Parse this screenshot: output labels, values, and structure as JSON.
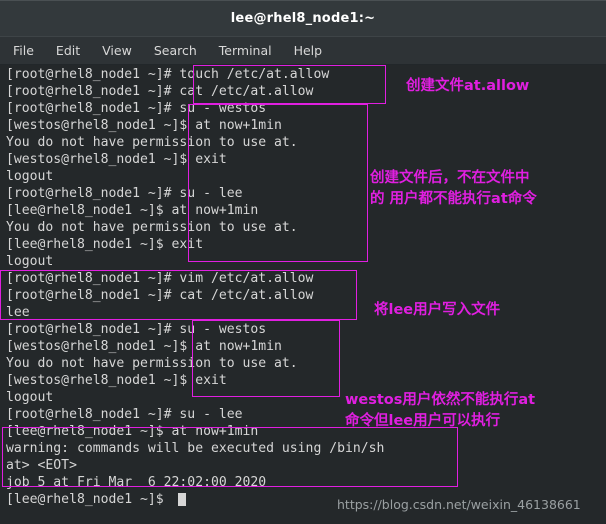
{
  "window": {
    "title": "lee@rhel8_node1:~"
  },
  "menubar": {
    "items": [
      {
        "label": "File"
      },
      {
        "label": "Edit"
      },
      {
        "label": "View"
      },
      {
        "label": "Search"
      },
      {
        "label": "Terminal"
      },
      {
        "label": "Help"
      }
    ]
  },
  "terminal": {
    "lines": [
      "[root@rhel8_node1 ~]# touch /etc/at.allow",
      "[root@rhel8_node1 ~]# cat /etc/at.allow",
      "[root@rhel8_node1 ~]# su - westos",
      "[westos@rhel8_node1 ~]$ at now+1min",
      "You do not have permission to use at.",
      "[westos@rhel8_node1 ~]$ exit",
      "logout",
      "[root@rhel8_node1 ~]# su - lee",
      "[lee@rhel8_node1 ~]$ at now+1min",
      "You do not have permission to use at.",
      "[lee@rhel8_node1 ~]$ exit",
      "logout",
      "[root@rhel8_node1 ~]# vim /etc/at.allow",
      "[root@rhel8_node1 ~]# cat /etc/at.allow",
      "lee",
      "[root@rhel8_node1 ~]# su - westos",
      "[westos@rhel8_node1 ~]$ at now+1min",
      "You do not have permission to use at.",
      "[westos@rhel8_node1 ~]$ exit",
      "logout",
      "[root@rhel8_node1 ~]# su - lee",
      "[lee@rhel8_node1 ~]$ at now+1min",
      "warning: commands will be executed using /bin/sh",
      "at> <EOT>",
      "job 5 at Fri Mar  6 22:02:00 2020",
      "[lee@rhel8_node1 ~]$"
    ]
  },
  "annotations": {
    "items": [
      {
        "text": "创建文件at.allow"
      },
      {
        "text": "创建文件后，不在文件中"
      },
      {
        "text": "的 用户都不能执行at命令"
      },
      {
        "text": "将lee用户写入文件"
      },
      {
        "text": "westos用户依然不能执行at"
      },
      {
        "text": "命令但lee用户可以执行"
      }
    ]
  },
  "watermark": {
    "text": "https://blog.csdn.net/weixin_46138661"
  },
  "colors": {
    "annotation": "#e01fe0",
    "terminal_bg": "#24282a",
    "terminal_fg": "#d6d6d6",
    "titlebar_bg": "#33393c"
  }
}
